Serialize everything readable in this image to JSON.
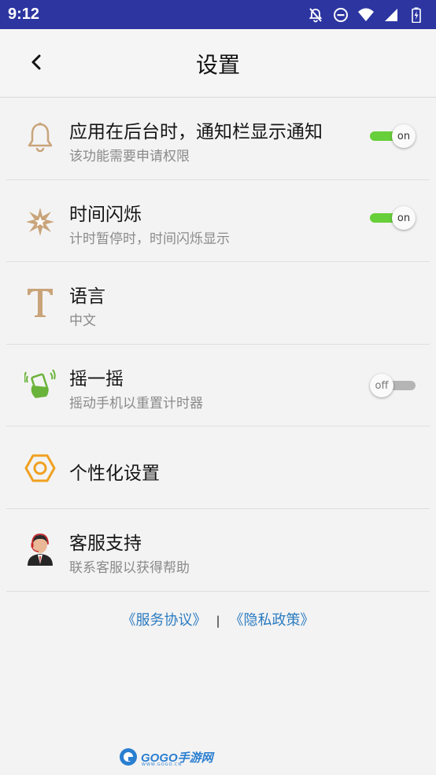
{
  "status_bar": {
    "time": "9:12",
    "icons": [
      "notifications-off-icon",
      "do-not-disturb-icon",
      "wifi-icon",
      "signal-icon",
      "battery-icon"
    ]
  },
  "header": {
    "back_icon": "chevron-left-icon",
    "title": "设置"
  },
  "settings": [
    {
      "icon": "bell-icon",
      "title": "应用在后台时，通知栏显示通知",
      "subtitle": "该功能需要申请权限",
      "toggle": "on"
    },
    {
      "icon": "flash-star-icon",
      "title": "时间闪烁",
      "subtitle": "计时暂停时，时间闪烁显示",
      "toggle": "on"
    },
    {
      "icon": "text-t-icon",
      "title": "语言",
      "subtitle": "中文"
    },
    {
      "icon": "shake-phone-icon",
      "title": "摇一摇",
      "subtitle": "摇动手机以重置计时器",
      "toggle": "off"
    },
    {
      "icon": "hexagon-nut-icon",
      "title": "个性化设置"
    },
    {
      "icon": "support-agent-icon",
      "title": "客服支持",
      "subtitle": "联系客服以获得帮助"
    }
  ],
  "footer": {
    "terms": "《服务协议》",
    "separator": "|",
    "privacy": "《隐私政策》"
  },
  "watermark": {
    "text": "GOGO手游网",
    "sub": "WWW.GOGO.CN"
  },
  "colors": {
    "status_bar": "#2c35a0",
    "toggle_on": "#67cf3a",
    "toggle_off": "#b5b5b5",
    "link": "#2b7bc0",
    "icon_tan": "#c9a47a",
    "icon_orange": "#f0a020",
    "icon_green": "#6ab33a"
  }
}
